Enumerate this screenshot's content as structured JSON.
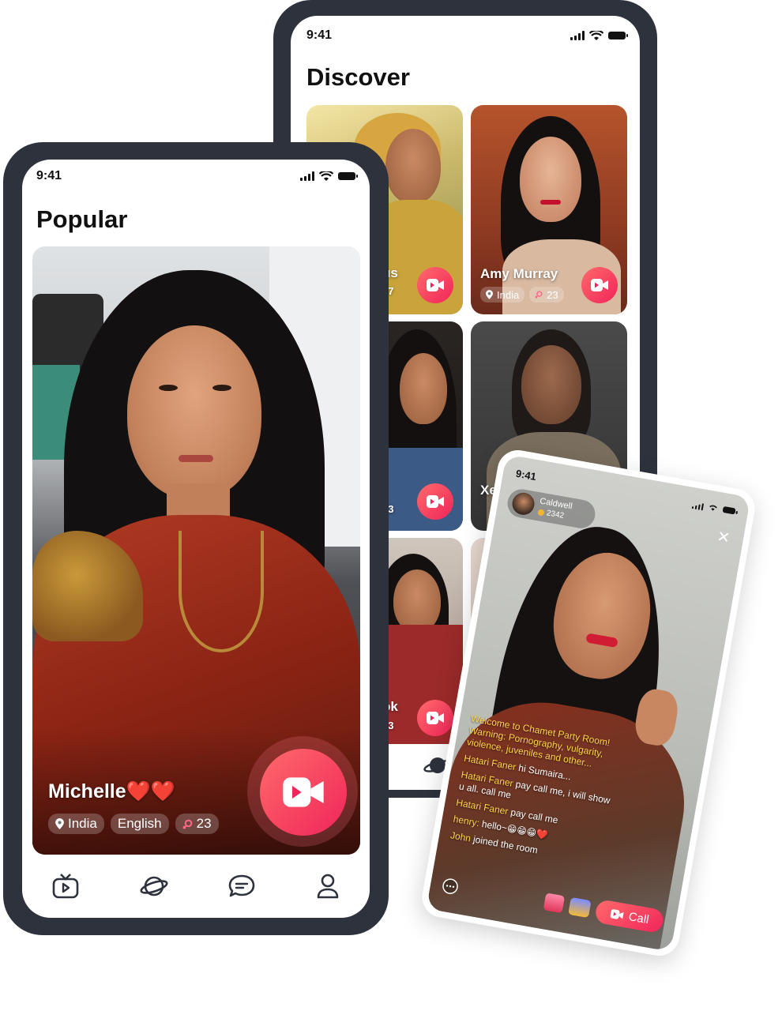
{
  "discover_phone": {
    "status_time": "9:41",
    "title": "Discover",
    "cards": [
      {
        "name_fragment": "us",
        "count_fragment": "27"
      },
      {
        "name": "Amy Murray",
        "country": "India",
        "count": "23"
      },
      {
        "count_fragment": "23"
      },
      {
        "name_fragment": "Xe"
      },
      {
        "name_fragment": "ok",
        "count_fragment": "23"
      },
      {}
    ]
  },
  "popular_phone": {
    "status_time": "9:41",
    "title": "Popular",
    "profile": {
      "name": "Michelle❤️❤️",
      "country": "India",
      "language": "English",
      "count": "23"
    },
    "tabs": [
      {
        "icon": "tv-icon"
      },
      {
        "icon": "planet-icon"
      },
      {
        "icon": "chat-icon"
      },
      {
        "icon": "profile-icon"
      }
    ]
  },
  "live_phone": {
    "status_time": "9:41",
    "host": {
      "name": "Caldwell",
      "score": "2342"
    },
    "messages": [
      {
        "text": "Welcome to Chamet Party Room! Warning: Pornography, vulgarity, violence, juveniles and other..."
      },
      {
        "user": "Hatari Faner",
        "text": "hi Sumaira..."
      },
      {
        "user": "Hatari Faner",
        "text": "pay call me, i will show u all. call me"
      },
      {
        "user": "Hatari Faner",
        "text": "pay call me"
      },
      {
        "user": "henry:",
        "text": "hello~😁😁😁❤️"
      },
      {
        "user": "John",
        "text": "joined the room"
      }
    ],
    "call_label": "Call"
  },
  "colors": {
    "frame": "#2d323c",
    "accent_start": "#ff6a6a",
    "accent_end": "#f0255a"
  }
}
